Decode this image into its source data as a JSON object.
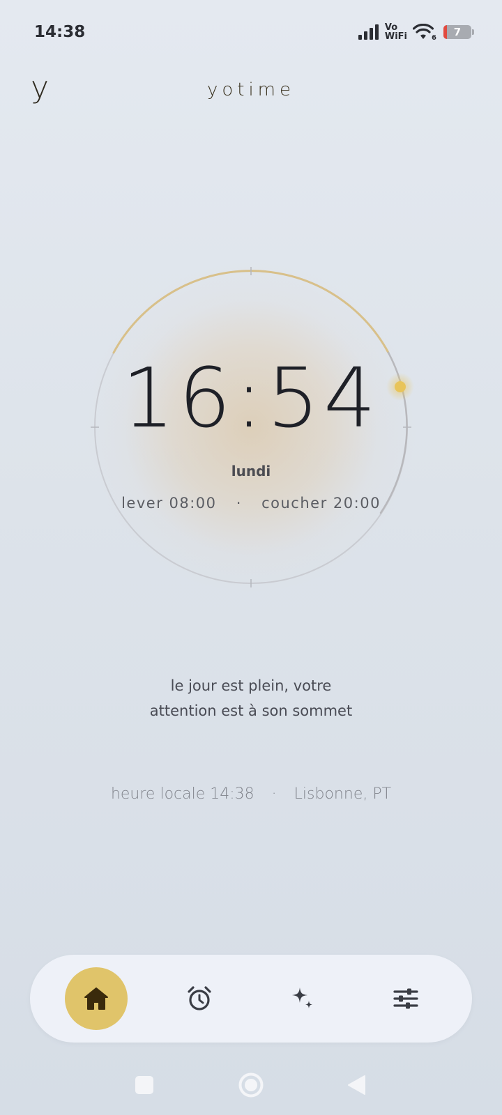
{
  "status_bar": {
    "time": "14:38",
    "volte_line1": "Vo",
    "volte_line2": "WiFi",
    "wifi_sub": "6",
    "battery": "7",
    "icons": [
      "cellular-signal-icon",
      "vowifi-icon",
      "wifi-icon",
      "battery-icon"
    ]
  },
  "header": {
    "logo": "y",
    "title": "yotime"
  },
  "clock": {
    "time": "16:54",
    "day": "lundi",
    "sunrise_label": "lever",
    "sunrise": "08:00",
    "separator": "·",
    "sunset_label": "coucher",
    "sunset": "20:00",
    "sun_color": "#e8c45a"
  },
  "message": {
    "line1": "le jour est plein, votre",
    "line2": "attention est à son sommet"
  },
  "local": {
    "label": "heure locale",
    "time": "14:38",
    "separator": "·",
    "location": "Lisbonne, PT"
  },
  "bottom_nav": {
    "active_color": "#e0c46a",
    "items": [
      {
        "icon": "home-icon",
        "active": true
      },
      {
        "icon": "alarm-clock-icon",
        "active": false
      },
      {
        "icon": "sparkle-icon",
        "active": false
      },
      {
        "icon": "sliders-icon",
        "active": false
      }
    ]
  },
  "system_nav": {
    "icons": [
      "recents-square-icon",
      "home-circle-icon",
      "back-triangle-icon"
    ]
  }
}
